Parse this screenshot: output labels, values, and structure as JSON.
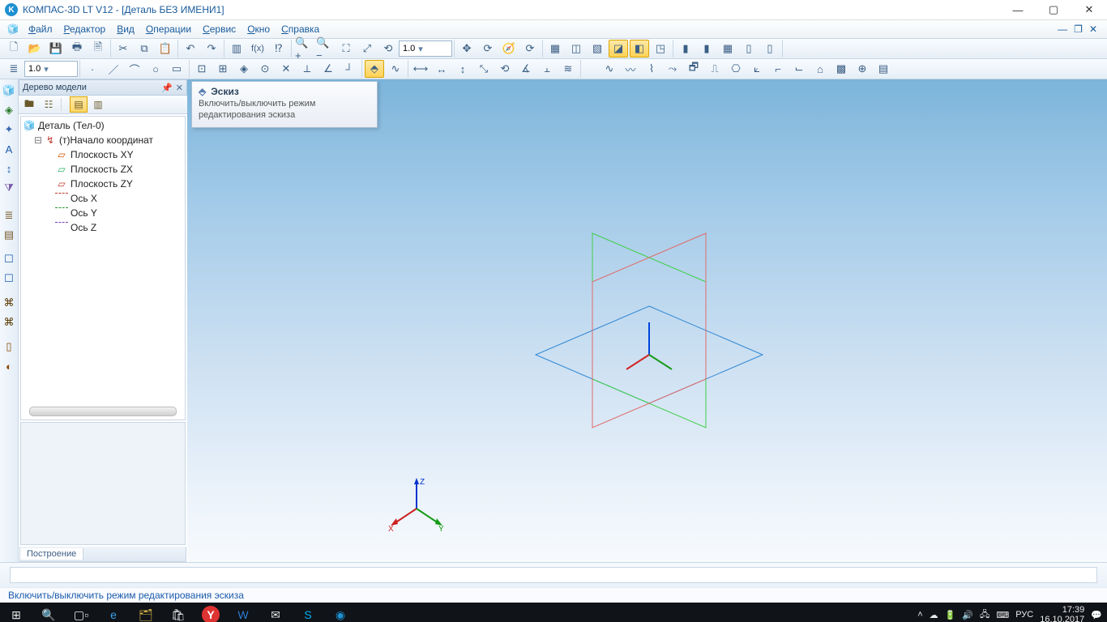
{
  "title": "КОМПАС-3D LT V12 - [Деталь БЕЗ ИМЕНИ1]",
  "menus": [
    "Файл",
    "Редактор",
    "Вид",
    "Операции",
    "Сервис",
    "Окно",
    "Справка"
  ],
  "scale1": "1.0",
  "scale2": "1.0",
  "panel_title": "Дерево модели",
  "tree": {
    "root": "Деталь (Тел-0)",
    "origin": "(т)Начало координат",
    "items": [
      "Плоскость XY",
      "Плоскость ZX",
      "Плоскость ZY",
      "Ось X",
      "Ось Y",
      "Ось Z"
    ]
  },
  "footer_tab": "Построение",
  "tooltip": {
    "title": "Эскиз",
    "body": "Включить/выключить режим редактирования эскиза"
  },
  "status_hint": "Включить/выключить режим редактирования эскиза",
  "gizmo": {
    "x": "X",
    "y": "Y",
    "z": "Z"
  },
  "taskbar": {
    "lang": "РУС",
    "time": "17:39",
    "date": "16.10.2017"
  }
}
